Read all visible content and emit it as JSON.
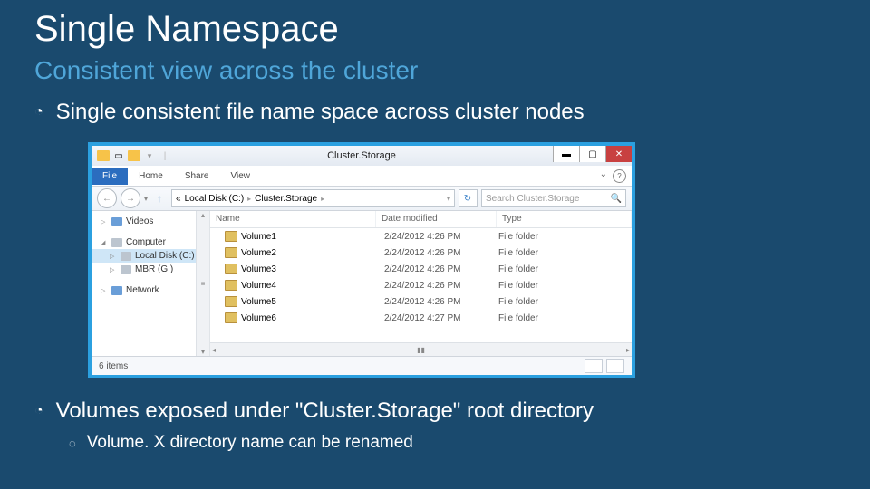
{
  "slide": {
    "title": "Single Namespace",
    "subtitle": "Consistent view across the cluster",
    "bullet1": "Single consistent file name space across cluster nodes",
    "bullet2": "Volumes exposed under \"Cluster.Storage\" root directory",
    "bullet3": "Volume. X directory name can be renamed"
  },
  "explorer": {
    "window_title": "Cluster.Storage",
    "ribbon": {
      "file": "File",
      "home": "Home",
      "share": "Share",
      "view": "View"
    },
    "breadcrumb": {
      "guillemet": "«",
      "parts": [
        "Local Disk (C:)",
        "Cluster.Storage"
      ]
    },
    "search_placeholder": "Search Cluster.Storage",
    "tree": {
      "videos": "Videos",
      "computer": "Computer",
      "local_disk": "Local Disk (C:)",
      "mbr": "MBR (G:)",
      "network": "Network"
    },
    "columns": {
      "name": "Name",
      "date": "Date modified",
      "type": "Type"
    },
    "rows": [
      {
        "name": "Volume1",
        "date": "2/24/2012 4:26 PM",
        "type": "File folder"
      },
      {
        "name": "Volume2",
        "date": "2/24/2012 4:26 PM",
        "type": "File folder"
      },
      {
        "name": "Volume3",
        "date": "2/24/2012 4:26 PM",
        "type": "File folder"
      },
      {
        "name": "Volume4",
        "date": "2/24/2012 4:26 PM",
        "type": "File folder"
      },
      {
        "name": "Volume5",
        "date": "2/24/2012 4:26 PM",
        "type": "File folder"
      },
      {
        "name": "Volume6",
        "date": "2/24/2012 4:27 PM",
        "type": "File folder"
      }
    ],
    "status": "6 items"
  }
}
